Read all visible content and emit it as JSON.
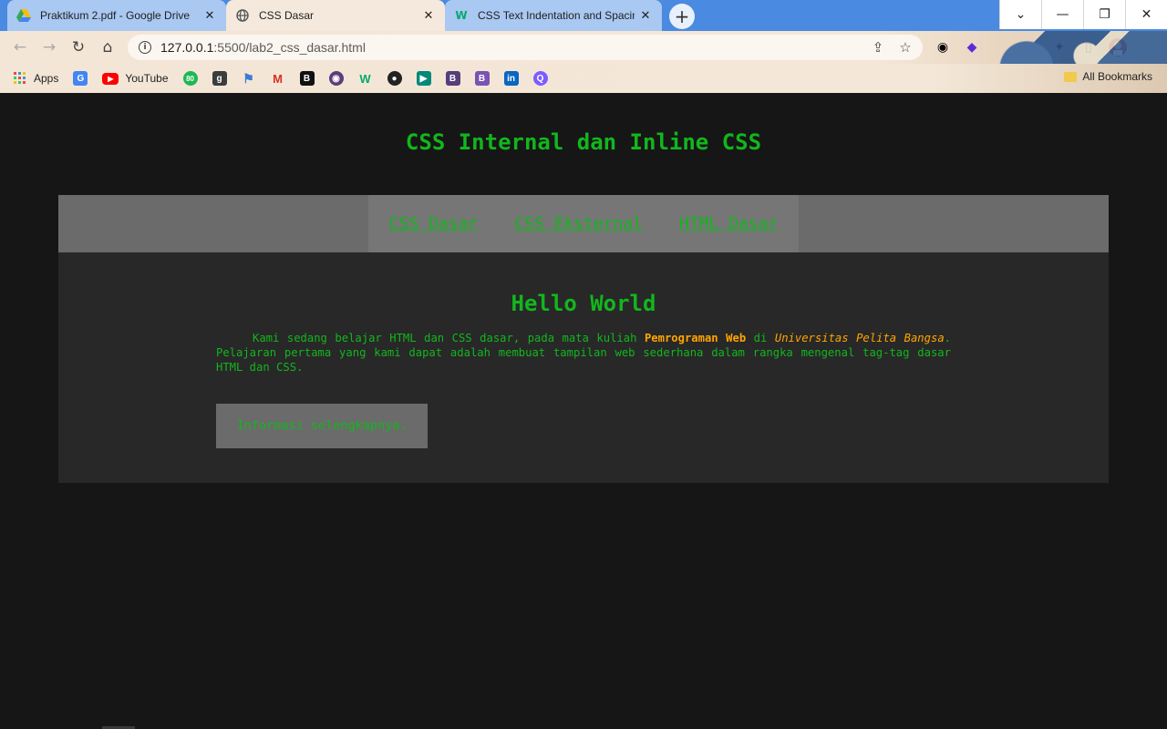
{
  "browser": {
    "tabs": [
      {
        "label": "Praktikum 2.pdf - Google Drive",
        "icon": "google-drive-icon",
        "active": false
      },
      {
        "label": "CSS Dasar",
        "icon": "globe-icon",
        "active": true
      },
      {
        "label": "CSS Text Indentation and Spacing",
        "icon": "w3schools-icon",
        "active": false
      }
    ],
    "new_tab": "+",
    "window_controls": {
      "minimize": "—",
      "restore": "❐",
      "close": "✕",
      "tab_search": "⌄"
    },
    "url": {
      "host": "127.0.0.1",
      "rest": ":5500/lab2_css_dasar.html"
    },
    "bookmarks": [
      {
        "label": "Apps",
        "icon": "apps-grid-icon",
        "color": "#e74c3c"
      },
      {
        "label": "",
        "icon": "google-translate-icon",
        "color": "#4285f4"
      },
      {
        "label": "YouTube",
        "icon": "youtube-icon",
        "color": "#ff0000"
      },
      {
        "label": "",
        "icon": "bookmark-80-icon",
        "color": "#1eb854"
      },
      {
        "label": "",
        "icon": "bookmark-g-icon",
        "color": "#3c3c3c"
      },
      {
        "label": "",
        "icon": "bookmark-flag-icon",
        "color": "#3a7bd5"
      },
      {
        "label": "",
        "icon": "gmail-icon",
        "color": "#d93025"
      },
      {
        "label": "",
        "icon": "bookmark-b-black-icon",
        "color": "#111111"
      },
      {
        "label": "",
        "icon": "bookmark-owl-icon",
        "color": "#5a3d7a"
      },
      {
        "label": "",
        "icon": "bookmark-w-icon",
        "color": "#04aa6d"
      },
      {
        "label": "",
        "icon": "github-icon",
        "color": "#222222"
      },
      {
        "label": "",
        "icon": "google-meet-icon",
        "color": "#00897b"
      },
      {
        "label": "",
        "icon": "bookmark-b-purple-icon",
        "color": "#563d7c"
      },
      {
        "label": "",
        "icon": "bootstrap-icon",
        "color": "#7952b3"
      },
      {
        "label": "",
        "icon": "linkedin-icon",
        "color": "#0a66c2"
      },
      {
        "label": "",
        "icon": "bookmark-q-icon",
        "color": "#7c5cff"
      }
    ],
    "all_bookmarks": "All Bookmarks"
  },
  "page": {
    "title": "CSS Internal dan Inline CSS",
    "nav": [
      "CSS Dasar",
      "CSS Eksternal",
      "HTML Dasar"
    ],
    "heading": "Hello World",
    "para_1": "Kami sedang belajar HTML dan CSS dasar, pada mata kuliah ",
    "para_bold": "Pemrograman Web",
    "para_2": " di ",
    "para_italic": "Universitas Pelita Bangsa",
    "para_3": ". Pelajaran pertama yang kami dapat adalah membuat tampilan web sederhana dalam rangka mengenal tag-tag dasar HTML dan CSS.",
    "more_button": "Informasi selengkapnya."
  },
  "colors": {
    "text_green": "#12b61d",
    "accent_orange": "#ffa500",
    "page_bg": "#161616",
    "container_bg": "#282828",
    "nav_bg": "#6b6b6b"
  }
}
